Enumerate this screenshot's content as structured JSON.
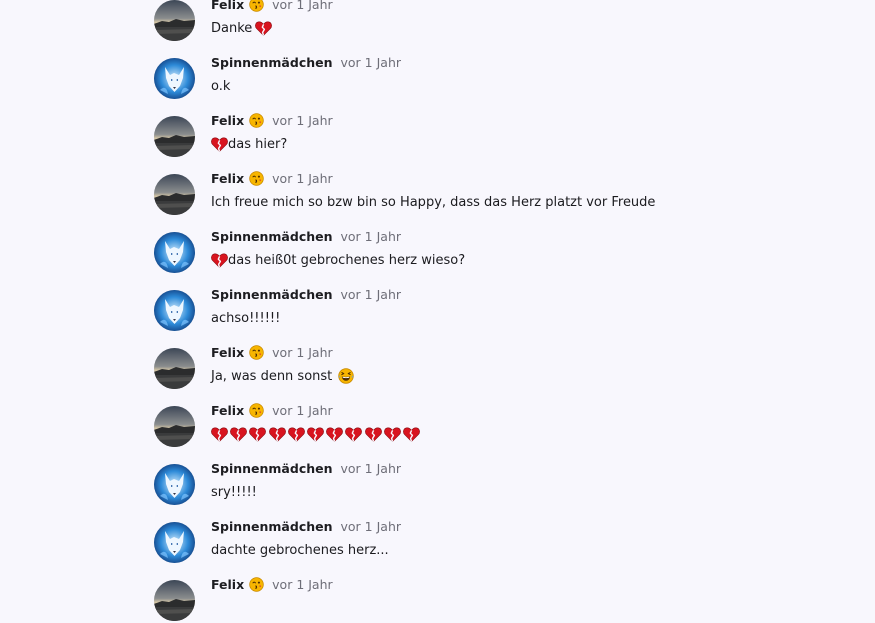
{
  "colors": {
    "background": "#f8f7fd",
    "name_text": "#1d1d21",
    "time_text": "#6e6e78",
    "heart": "#d8141f"
  },
  "messages": [
    {
      "user": "Felix",
      "avatar": "landscape",
      "name_emoji": "winking-kiss-emoji",
      "time": "vor 1 Jahr",
      "text": "Danke",
      "trailing_icon": "broken-heart-icon"
    },
    {
      "user": "Spinnenmädchen",
      "avatar": "wolf",
      "time": "vor 1 Jahr",
      "text": "o.k"
    },
    {
      "user": "Felix",
      "avatar": "landscape",
      "name_emoji": "winking-kiss-emoji",
      "time": "vor 1 Jahr",
      "leading_icon": "broken-heart-icon",
      "text": "das hier?"
    },
    {
      "user": "Felix",
      "avatar": "landscape",
      "name_emoji": "winking-kiss-emoji",
      "time": "vor 1 Jahr",
      "text": "Ich freue mich so bzw bin so Happy, dass das Herz platzt vor Freude"
    },
    {
      "user": "Spinnenmädchen",
      "avatar": "wolf",
      "time": "vor 1 Jahr",
      "leading_icon": "broken-heart-icon",
      "text": "das heiß0t gebrochenes herz wieso?"
    },
    {
      "user": "Spinnenmädchen",
      "avatar": "wolf",
      "time": "vor 1 Jahr",
      "text": "achso!!!!!!"
    },
    {
      "user": "Felix",
      "avatar": "landscape",
      "name_emoji": "winking-kiss-emoji",
      "time": "vor 1 Jahr",
      "text": "Ja, was denn sonst",
      "trailing_icon": "laughing-tears-emoji"
    },
    {
      "user": "Felix",
      "avatar": "landscape",
      "name_emoji": "winking-kiss-emoji",
      "time": "vor 1 Jahr",
      "text": "",
      "heart_count": 11
    },
    {
      "user": "Spinnenmädchen",
      "avatar": "wolf",
      "time": "vor 1 Jahr",
      "text": "sry!!!!!"
    },
    {
      "user": "Spinnenmädchen",
      "avatar": "wolf",
      "time": "vor 1 Jahr",
      "text": "dachte gebrochenes herz..."
    },
    {
      "user": "Felix",
      "avatar": "landscape",
      "name_emoji": "winking-kiss-emoji",
      "time": "vor 1 Jahr",
      "text": ""
    }
  ]
}
